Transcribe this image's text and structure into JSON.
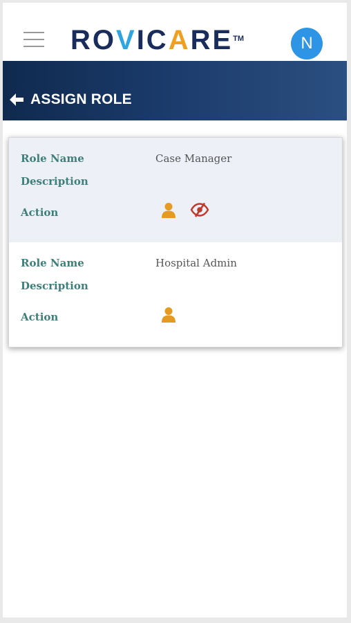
{
  "app": {
    "logo_text": "ROVICARE",
    "trademark": "TM",
    "avatar_initial": "N"
  },
  "header": {
    "title": "ASSIGN ROLE"
  },
  "labels": {
    "role_name": "Role Name",
    "description": "Description",
    "action": "Action"
  },
  "roles": [
    {
      "role_name": "Case Manager",
      "description": "",
      "actions": [
        "user-icon",
        "eye-slash-icon"
      ]
    },
    {
      "role_name": "Hospital Admin",
      "description": "",
      "actions": [
        "user-icon"
      ]
    }
  ],
  "colors": {
    "header_start": "#102a4e",
    "header_end": "#2b4f80",
    "label_teal": "#3f7f7a",
    "icon_orange": "#e59a24",
    "icon_red": "#c0392b",
    "avatar_blue": "#2d94e6",
    "row_highlight": "#edf0f7"
  }
}
